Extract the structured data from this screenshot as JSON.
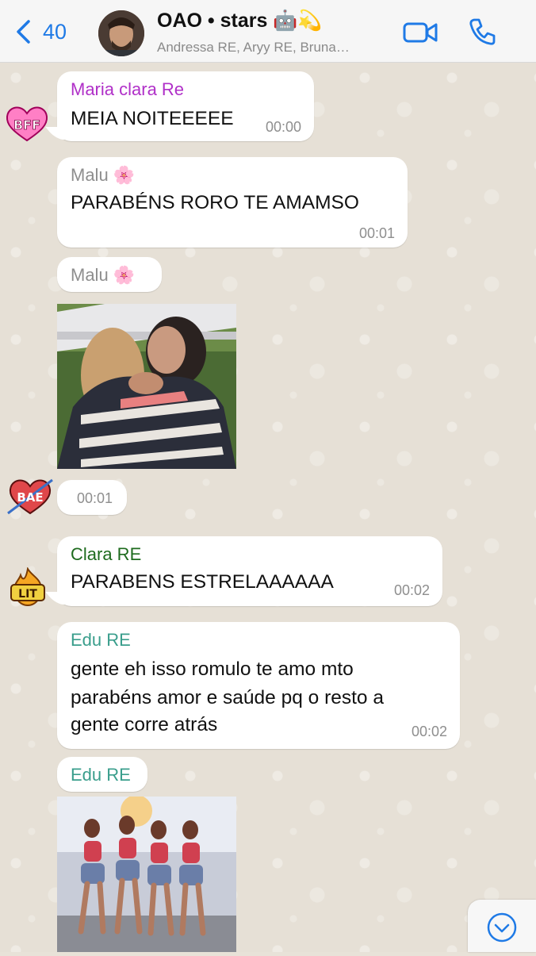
{
  "header": {
    "back_count": "40",
    "title": "OAO • stars 🤖💫",
    "subtitle": "Andressa RE, Aryy RE, Bruna…"
  },
  "messages": [
    {
      "sender": "Maria clara Re",
      "sender_color": "#b030c8",
      "text": "MEIA NOITEEEEE",
      "time": "00:00",
      "sticker": "BFF"
    },
    {
      "sender": "Malu 🌸",
      "sender_color": "#8e8e8e",
      "text": "PARABÉNS RORO TE AMAMSO",
      "time": "00:01"
    },
    {
      "sender": "Malu 🌸",
      "sender_color": "#8e8e8e",
      "time": "00:01",
      "sticker": "BAE",
      "image": "hugging-women-photo"
    },
    {
      "sender": "Clara RE",
      "sender_color": "#1e6b1e",
      "text": "PARABENS ESTRELAAAAAA",
      "time": "00:02",
      "sticker": "LIT"
    },
    {
      "sender": "Edu RE",
      "sender_color": "#3a9e8c",
      "text_lines": [
        "gente eh isso romulo te amo mto",
        "parabéns amor e saúde pq o resto a",
        "gente corre atrás"
      ],
      "time": "00:02"
    },
    {
      "sender": "Edu RE",
      "sender_color": "#3a9e8c",
      "image": "dancers-photo"
    }
  ],
  "colors": {
    "accent": "#1f7ae6",
    "bubble": "#ffffff",
    "wallpaper": "#e6e0d6"
  },
  "icons": [
    "back-chevron-icon",
    "video-call-icon",
    "phone-call-icon",
    "scroll-down-icon"
  ]
}
